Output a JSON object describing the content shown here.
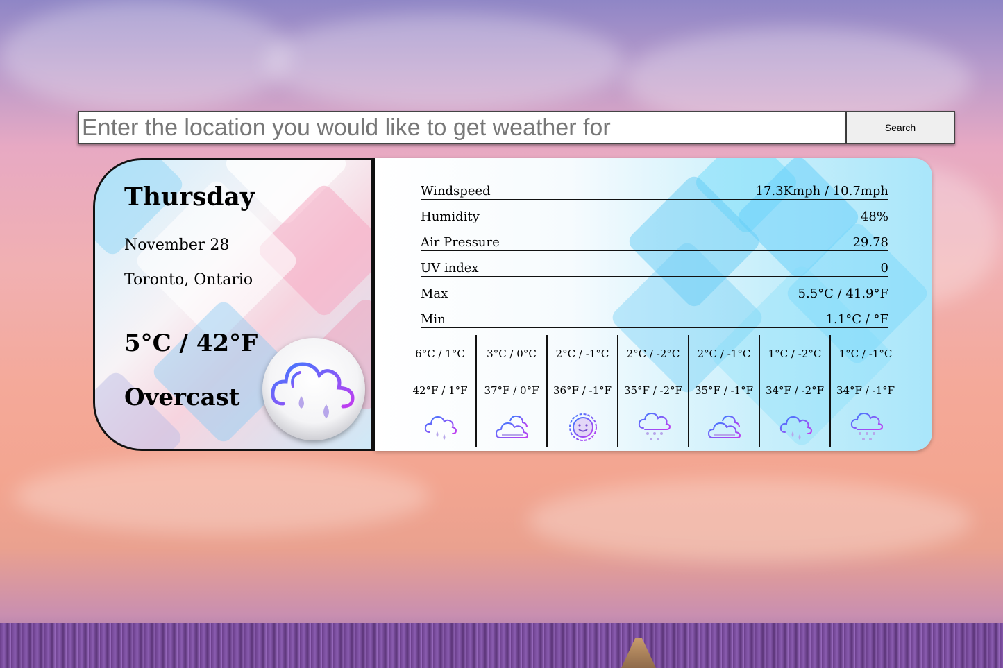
{
  "search": {
    "placeholder": "Enter the location you would like to get weather for",
    "button_label": "Search"
  },
  "current": {
    "day": "Thursday",
    "date": "November 28",
    "location": "Toronto, Ontario",
    "temperature": "5°C / 42°F",
    "condition": "Overcast",
    "icon": "cloud-rain-icon"
  },
  "stats": [
    {
      "label": "Windspeed",
      "value": "17.3Kmph / 10.7mph"
    },
    {
      "label": "Humidity",
      "value": "48%"
    },
    {
      "label": "Air Pressure",
      "value": "29.78"
    },
    {
      "label": "UV index",
      "value": "0"
    },
    {
      "label": "Max",
      "value": "5.5°C / 41.9°F"
    },
    {
      "label": "Min",
      "value": "1.1°C / °F"
    }
  ],
  "forecast": [
    {
      "celsius": "6°C / 1°C",
      "fahrenheit": "42°F / 1°F",
      "icon": "cloud-rain-icon"
    },
    {
      "celsius": "3°C / 0°C",
      "fahrenheit": "37°F / 0°F",
      "icon": "cloudy-icon"
    },
    {
      "celsius": "2°C / -1°C",
      "fahrenheit": "36°F / -1°F",
      "icon": "sun-icon"
    },
    {
      "celsius": "2°C / -2°C",
      "fahrenheit": "35°F / -2°F",
      "icon": "cloud-snow-icon"
    },
    {
      "celsius": "2°C / -1°C",
      "fahrenheit": "35°F / -1°F",
      "icon": "cloudy-icon"
    },
    {
      "celsius": "1°C / -2°C",
      "fahrenheit": "34°F / -2°F",
      "icon": "cloud-rain-icon"
    },
    {
      "celsius": "1°C / -1°C",
      "fahrenheit": "34°F / -1°F",
      "icon": "cloud-snow-icon"
    }
  ],
  "colors": {
    "icon_gradient_start": "#3c7bff",
    "icon_gradient_end": "#c23cf0",
    "card_border": "#111111"
  }
}
